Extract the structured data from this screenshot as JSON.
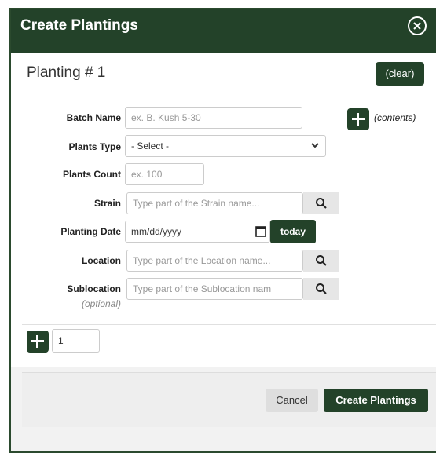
{
  "dialog": {
    "title": "Create Plantings",
    "close_glyph": "✕"
  },
  "section": {
    "title": "Planting # 1",
    "clear_label": "(clear)",
    "contents_label": "(contents)"
  },
  "form": {
    "batch_name": {
      "label": "Batch Name",
      "placeholder": "ex. B. Kush 5-30"
    },
    "plants_type": {
      "label": "Plants Type",
      "value": "- Select -"
    },
    "plants_count": {
      "label": "Plants Count",
      "placeholder": "ex. 100"
    },
    "strain": {
      "label": "Strain",
      "placeholder": "Type part of the Strain name..."
    },
    "planting_date": {
      "label": "Planting Date",
      "placeholder": "mm/dd/yyyy",
      "today_label": "today"
    },
    "location": {
      "label": "Location",
      "placeholder": "Type part of the Location name..."
    },
    "sublocation": {
      "label": "Sublocation",
      "optional_label": "(optional)",
      "placeholder": "Type part of the Sublocation nam"
    }
  },
  "add_row": {
    "count_value": "1"
  },
  "footer": {
    "cancel_label": "Cancel",
    "create_label": "Create Plantings"
  },
  "colors": {
    "primary": "#234229",
    "background": "#f2f2f2"
  },
  "icons": {
    "close": "close-icon",
    "search": "search-icon",
    "calendar": "calendar-icon",
    "plus": "plus-icon",
    "chevron": "chevron-down-icon"
  }
}
